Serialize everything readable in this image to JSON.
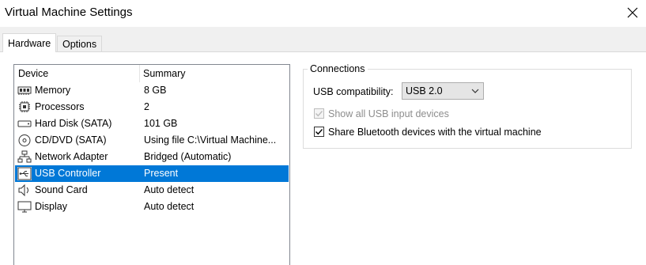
{
  "window": {
    "title": "Virtual Machine Settings"
  },
  "tabs": [
    {
      "label": "Hardware"
    },
    {
      "label": "Options"
    }
  ],
  "device_list": {
    "columns": {
      "device": "Device",
      "summary": "Summary"
    },
    "rows": [
      {
        "icon": "memory-icon",
        "device": "Memory",
        "summary": "8 GB"
      },
      {
        "icon": "processor-icon",
        "device": "Processors",
        "summary": "2"
      },
      {
        "icon": "hard-disk-icon",
        "device": "Hard Disk (SATA)",
        "summary": "101 GB"
      },
      {
        "icon": "cd-dvd-icon",
        "device": "CD/DVD (SATA)",
        "summary": "Using file C:\\Virtual Machine..."
      },
      {
        "icon": "network-adapter-icon",
        "device": "Network Adapter",
        "summary": "Bridged (Automatic)"
      },
      {
        "icon": "usb-icon",
        "device": "USB Controller",
        "summary": "Present",
        "selected": true
      },
      {
        "icon": "speaker-icon",
        "device": "Sound Card",
        "summary": "Auto detect"
      },
      {
        "icon": "display-icon",
        "device": "Display",
        "summary": "Auto detect"
      }
    ],
    "selected_color": "#0078d7"
  },
  "connections": {
    "legend": "Connections",
    "usb_compat_label": "USB compatibility:",
    "usb_compat_value": "USB 2.0",
    "show_all_input": {
      "label": "Show all USB input devices",
      "checked": true,
      "enabled": false
    },
    "share_bluetooth": {
      "label": "Share Bluetooth devices with the virtual machine",
      "checked": true,
      "enabled": true
    }
  }
}
